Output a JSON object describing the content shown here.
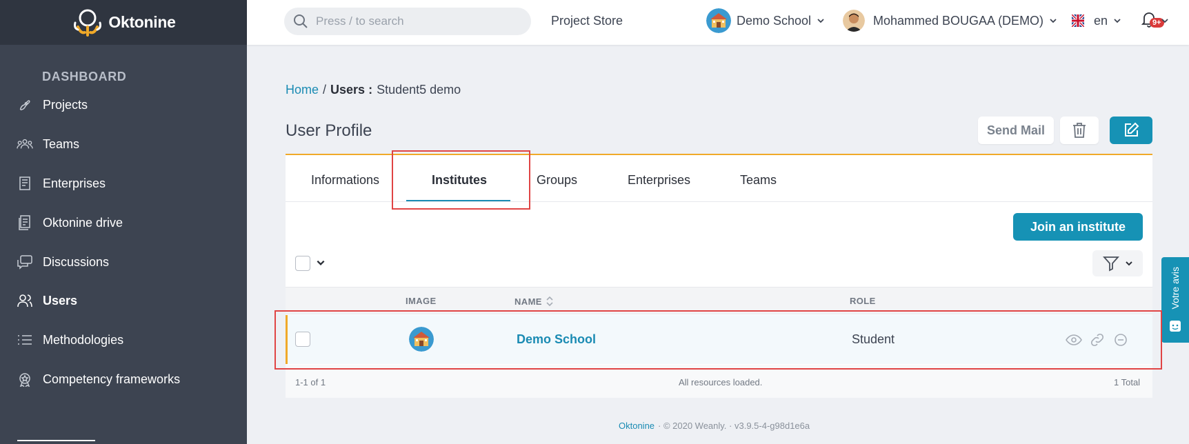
{
  "app": {
    "logo": "Oktonine"
  },
  "sidebar": {
    "section": "DASHBOARD",
    "items": [
      {
        "label": "Projects",
        "icon": "rocket-icon"
      },
      {
        "label": "Teams",
        "icon": "group-icon"
      },
      {
        "label": "Enterprises",
        "icon": "building-icon"
      },
      {
        "label": "Oktonine drive",
        "icon": "document-icon"
      },
      {
        "label": "Discussions",
        "icon": "chat-icon"
      },
      {
        "label": "Users",
        "icon": "users-icon",
        "active": true
      },
      {
        "label": "Methodologies",
        "icon": "list-icon"
      },
      {
        "label": "Competency frameworks",
        "icon": "badge-icon"
      }
    ]
  },
  "header": {
    "search_placeholder": "Press / to search",
    "project_store": "Project Store",
    "school": "Demo School",
    "user": "Mohammed BOUGAA (DEMO)",
    "language": "en",
    "notifications_badge": "9+"
  },
  "breadcrumb": {
    "home": "Home",
    "separator": "/",
    "section": "Users :",
    "current": "Student5 demo"
  },
  "profile": {
    "title": "User Profile",
    "send_mail": "Send Mail",
    "tabs": [
      "Informations",
      "Institutes",
      "Groups",
      "Enterprises",
      "Teams"
    ],
    "active_tab": "Institutes"
  },
  "institutes": {
    "join_button": "Join an institute",
    "columns": {
      "image": "IMAGE",
      "name": "NAME",
      "role": "ROLE"
    },
    "rows": [
      {
        "name": "Demo School",
        "role": "Student"
      }
    ],
    "footer": {
      "range": "1-1 of 1",
      "status": "All resources loaded.",
      "total": "1 Total"
    }
  },
  "footer": {
    "link": "Oktonine",
    "rest": "· © 2020 Weanly. · v3.9.5-4-g98d1e6a"
  },
  "feedback": {
    "label": "Votre avis"
  },
  "colors": {
    "primary": "#1692b5",
    "accent": "#f0a928",
    "sidebar": "#3d4451",
    "highlight": "#e04444"
  }
}
